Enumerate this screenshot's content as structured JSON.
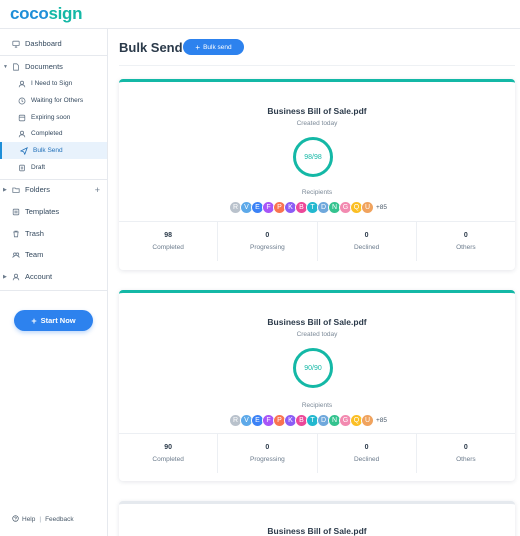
{
  "app": {
    "logo_part1": "coco",
    "logo_part2": "sign"
  },
  "sidebar": {
    "dashboard": "Dashboard",
    "documents": "Documents",
    "need_to_sign": "I Need to Sign",
    "waiting": "Waiting for Others",
    "expiring": "Expiring soon",
    "completed": "Completed",
    "bulk_send": "Bulk Send",
    "draft": "Draft",
    "folders": "Folders",
    "templates": "Templates",
    "trash": "Trash",
    "team": "Team",
    "account": "Account",
    "start_now": "Start Now",
    "help": "Help",
    "feedback": "Feedback"
  },
  "main": {
    "title": "Bulk Send",
    "bulk_send_button": "Bulk send"
  },
  "cards": [
    {
      "title": "Business Bill of Sale.pdf",
      "created": "Created today",
      "progress": "98/98",
      "recipients_label": "Recipients",
      "more": "+85",
      "stats": [
        {
          "value": "98",
          "label": "Completed"
        },
        {
          "value": "0",
          "label": "Progressing"
        },
        {
          "value": "0",
          "label": "Declined"
        },
        {
          "value": "0",
          "label": "Others"
        }
      ]
    },
    {
      "title": "Business Bill of Sale.pdf",
      "created": "Created today",
      "progress": "90/90",
      "recipients_label": "Recipients",
      "more": "+85",
      "stats": [
        {
          "value": "90",
          "label": "Completed"
        },
        {
          "value": "0",
          "label": "Progressing"
        },
        {
          "value": "0",
          "label": "Declined"
        },
        {
          "value": "0",
          "label": "Others"
        }
      ]
    },
    {
      "title": "Business Bill of Sale.pdf"
    }
  ],
  "avatars": [
    {
      "letter": "R",
      "color": "#b9c2cc"
    },
    {
      "letter": "V",
      "color": "#5da9e9"
    },
    {
      "letter": "E",
      "color": "#3b82f6"
    },
    {
      "letter": "F",
      "color": "#a855f7"
    },
    {
      "letter": "P",
      "color": "#f97350"
    },
    {
      "letter": "K",
      "color": "#8b5cf6"
    },
    {
      "letter": "B",
      "color": "#ec4899"
    },
    {
      "letter": "T",
      "color": "#22b8cf"
    },
    {
      "letter": "D",
      "color": "#6fa8dc"
    },
    {
      "letter": "N",
      "color": "#34c38f"
    },
    {
      "letter": "G",
      "color": "#f28ab0"
    },
    {
      "letter": "Q",
      "color": "#fbbf24"
    },
    {
      "letter": "U",
      "color": "#f0a35e"
    }
  ]
}
